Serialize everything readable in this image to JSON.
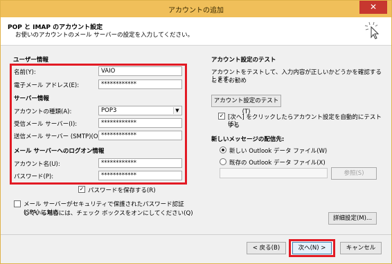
{
  "window": {
    "title": "アカウントの追加",
    "close": "✕"
  },
  "header": {
    "title": "POP と IMAP のアカウント設定",
    "subtitle": "お使いのアカウントのメール サーバーの設定を入力してください。"
  },
  "user_info": {
    "title": "ユーザー情報",
    "name_label": "名前(Y):",
    "name_value": "VAIO",
    "email_label": "電子メール アドレス(E):",
    "email_value": "************"
  },
  "server_info": {
    "title": "サーバー情報",
    "account_type_label": "アカウントの種類(A):",
    "account_type_value": "POP3",
    "incoming_label": "受信メール サーバー(I):",
    "incoming_value": "************",
    "outgoing_label": "送信メール サーバー (SMTP)(O):",
    "outgoing_value": "************"
  },
  "logon_info": {
    "title": "メール サーバーへのログオン情報",
    "account_name_label": "アカウント名(U):",
    "account_name_value": "************",
    "password_label": "パスワード(P):",
    "password_value": "************",
    "remember_password_label": "パスワードを保存する(R)",
    "remember_password_checked": "✓"
  },
  "spa": {
    "label_line1": "メール サーバーがセキュリティで保護されたパスワード認証 (SPA) に対応",
    "label_line2": "している場合には、チェック ボックスをオンにしてください(Q)"
  },
  "test_settings": {
    "title": "アカウント設定のテスト",
    "description_line1": "アカウントをテストして、入力内容が正しいかどうかを確認することをお勧め",
    "description_line2": "します。",
    "test_button": "アカウント設定のテスト(T)",
    "auto_test_line1": "[次へ] をクリックしたらアカウント設定を自動的にテストする",
    "auto_test_line2": "(S)",
    "auto_test_checked": "✓"
  },
  "delivery": {
    "title": "新しいメッセージの配信先:",
    "new_file_label": "新しい Outlook データ ファイル(W)",
    "existing_file_label": "既存の Outlook データ ファイル(X)",
    "browse_button": "参照(S)"
  },
  "buttons": {
    "more_settings": "詳細設定(M)...",
    "back": "< 戻る(B)",
    "next": "次へ(N) >",
    "cancel": "キャンセル"
  },
  "colors": {
    "highlight": "#e21a24",
    "titlebar": "#f0bf5a"
  }
}
